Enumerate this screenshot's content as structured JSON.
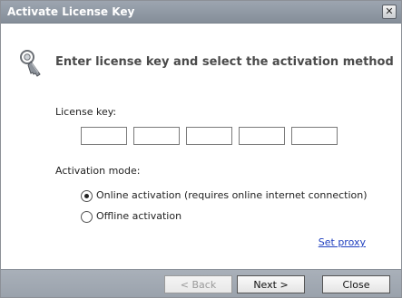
{
  "window": {
    "title": "Activate License Key",
    "close_glyph": "✕"
  },
  "header": {
    "icon": "key-icon",
    "text": "Enter license key and select the activation method"
  },
  "license": {
    "label": "License key:",
    "fields": [
      "",
      "",
      "",
      "",
      ""
    ]
  },
  "activation": {
    "label": "Activation mode:",
    "options": [
      {
        "label": "Online activation (requires online internet connection)",
        "selected": true
      },
      {
        "label": "Offline activation",
        "selected": false
      }
    ]
  },
  "links": {
    "set_proxy": "Set proxy"
  },
  "buttons": {
    "back": "< Back",
    "next": "Next >",
    "close": "Close",
    "back_enabled": false
  },
  "colors": {
    "titlebar": "#8f98a3",
    "footer": "#a3aab3",
    "link": "#1f3fbf"
  }
}
